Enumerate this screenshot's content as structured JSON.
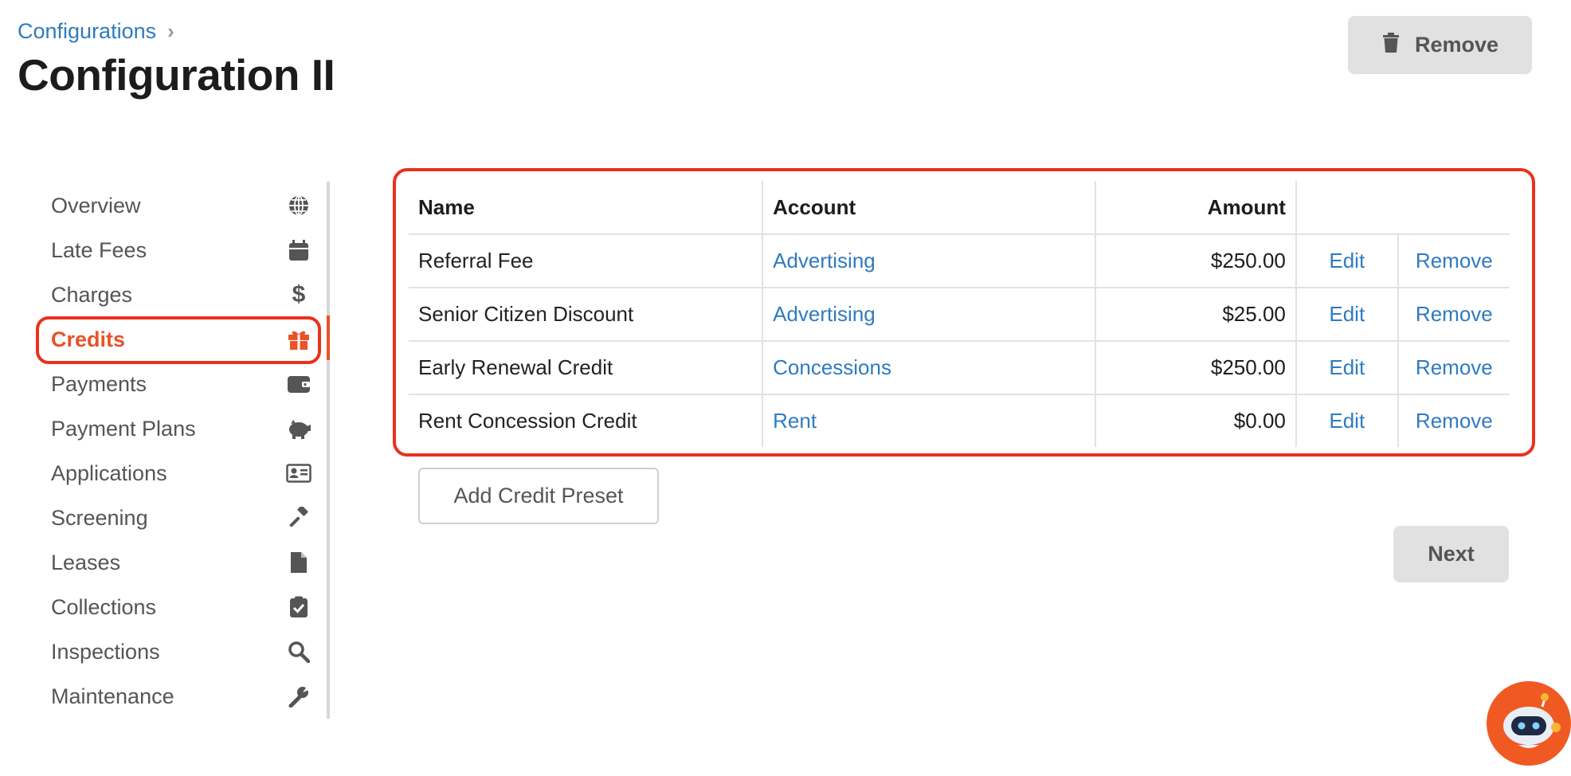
{
  "breadcrumb": {
    "parent": "Configurations",
    "separator": "›"
  },
  "page": {
    "title": "Configuration II"
  },
  "header": {
    "remove_label": "Remove"
  },
  "sidebar": {
    "items": [
      {
        "label": "Overview",
        "icon": "globe-icon"
      },
      {
        "label": "Late Fees",
        "icon": "calendar-icon"
      },
      {
        "label": "Charges",
        "icon": "dollar-icon"
      },
      {
        "label": "Credits",
        "icon": "gift-icon",
        "active": true
      },
      {
        "label": "Payments",
        "icon": "wallet-icon"
      },
      {
        "label": "Payment Plans",
        "icon": "piggy-bank-icon"
      },
      {
        "label": "Applications",
        "icon": "id-card-icon"
      },
      {
        "label": "Screening",
        "icon": "gavel-icon"
      },
      {
        "label": "Leases",
        "icon": "file-icon"
      },
      {
        "label": "Collections",
        "icon": "clipboard-check-icon"
      },
      {
        "label": "Inspections",
        "icon": "search-icon"
      },
      {
        "label": "Maintenance",
        "icon": "wrench-icon"
      }
    ]
  },
  "table": {
    "columns": [
      "Name",
      "Account",
      "Amount",
      ""
    ],
    "rows": [
      {
        "name": "Referral Fee",
        "account": "Advertising",
        "amount": "$250.00",
        "edit": "Edit",
        "remove": "Remove"
      },
      {
        "name": "Senior Citizen Discount",
        "account": "Advertising",
        "amount": "$25.00",
        "edit": "Edit",
        "remove": "Remove"
      },
      {
        "name": "Early Renewal Credit",
        "account": "Concessions",
        "amount": "$250.00",
        "edit": "Edit",
        "remove": "Remove"
      },
      {
        "name": "Rent Concession Credit",
        "account": "Rent",
        "amount": "$0.00",
        "edit": "Edit",
        "remove": "Remove"
      }
    ]
  },
  "actions": {
    "add_preset": "Add Credit Preset",
    "next": "Next"
  },
  "colors": {
    "accent": "#e8532a",
    "link": "#2f7bbf",
    "highlight": "#e8321c",
    "button_bg": "#e1e1e1"
  }
}
